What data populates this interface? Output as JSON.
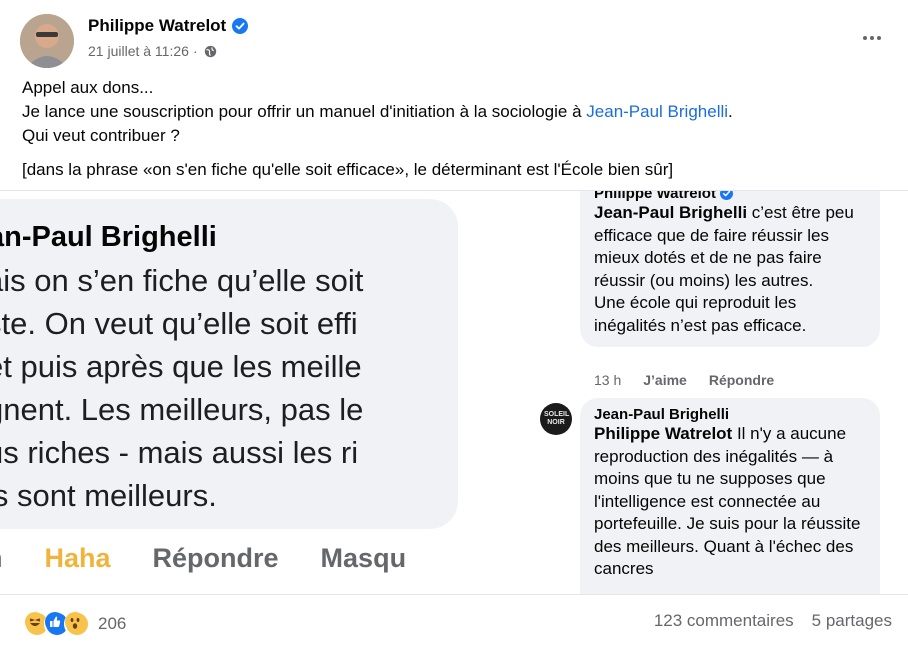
{
  "post": {
    "author": "Philippe Watrelot",
    "date": "21 juillet à 11:26",
    "separator": "·",
    "text_line1": "Appel aux dons...",
    "text_line2_prefix": "Je lance une souscription pour offrir un manuel d'initiation à la sociologie à ",
    "text_line2_link": "Jean-Paul Brighelli",
    "text_line2_suffix": ".",
    "text_line3": "Qui veut contribuer ?",
    "text_note": "[dans la phrase «on s'en fiche qu'elle soit efficace», le déterminant est l'École bien sûr]"
  },
  "zoomed_comment": {
    "name": "an-Paul Brighelli",
    "lines": [
      "ais on s’en fiche qu’elle soit",
      "ste. On veut qu’elle soit effi",
      "et puis après que les meille",
      "gnent. Les meilleurs, pas le",
      "us riches - mais aussi les ri",
      "ls sont meilleurs."
    ],
    "actions": [
      "h",
      "Haha",
      "Répondre",
      "Masqu"
    ]
  },
  "comment1": {
    "author_partial": "Philippe Watrelot",
    "tag": "Jean-Paul Brighelli",
    "body": " c’est être peu efficace que de faire réussir les mieux dotés et de ne pas faire réussir (ou moins) les autres.",
    "body2": "Une école qui reproduit les inégalités n’est pas efficace.",
    "time": "13 h",
    "like": "J’aime",
    "reply": "Répondre"
  },
  "comment2": {
    "author": "Jean-Paul Brighelli",
    "avatar_text": "SOLEIL NOIR",
    "tag": "Philippe Watrelot",
    "body": " Il n'y a aucune reproduction des inégalités — à moins que tu ne supposes que l'intelligence est connectée au portefeuille. Je suis pour la réussite des meilleurs. Quant à l'échec des cancres"
  },
  "footer": {
    "reaction_count": "206",
    "comments": "123 commentaires",
    "shares": "5 partages"
  },
  "colors": {
    "link": "#1a6ed8",
    "verified": "#1877f2",
    "haha": "#f0b43c",
    "bubble": "#f0f2f5",
    "secondary_text": "#65676b"
  }
}
